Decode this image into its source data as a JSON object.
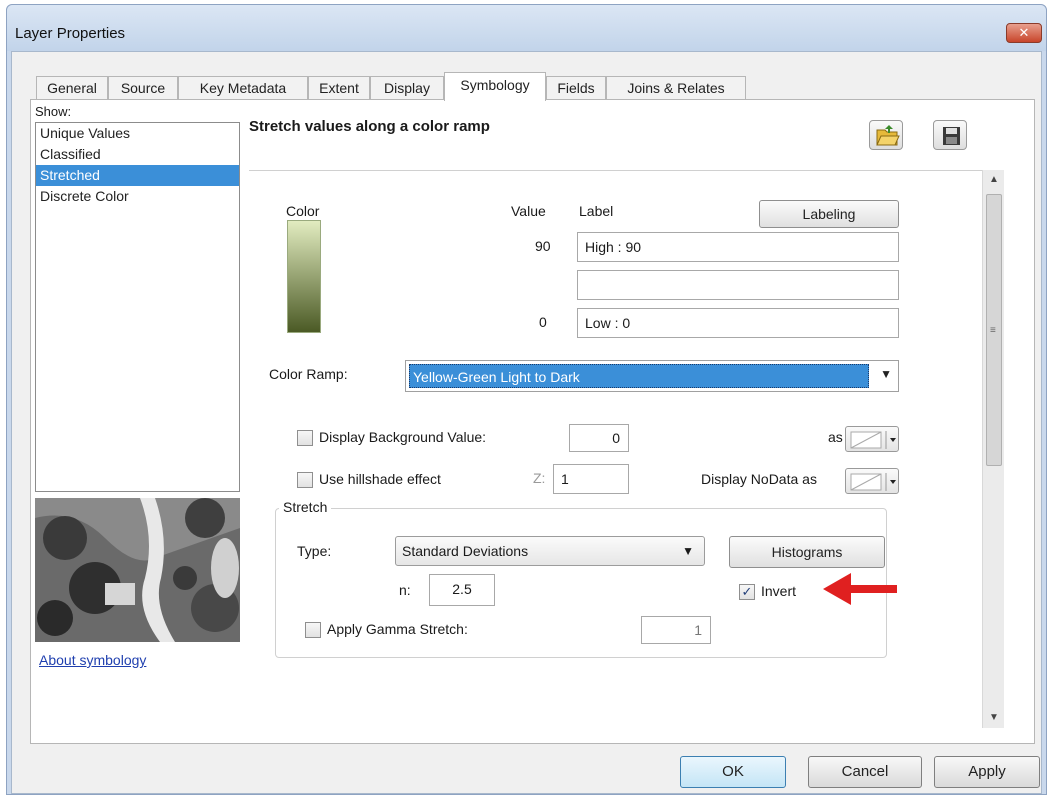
{
  "window": {
    "title": "Layer Properties",
    "close_glyph": "✕"
  },
  "tabs": [
    {
      "label": "General"
    },
    {
      "label": "Source"
    },
    {
      "label": "Key Metadata"
    },
    {
      "label": "Extent"
    },
    {
      "label": "Display"
    },
    {
      "label": "Symbology",
      "active": true
    },
    {
      "label": "Fields"
    },
    {
      "label": "Joins & Relates"
    }
  ],
  "show": {
    "label": "Show:",
    "items": [
      {
        "label": "Unique Values"
      },
      {
        "label": "Classified"
      },
      {
        "label": "Stretched",
        "selected": true
      },
      {
        "label": "Discrete Color"
      }
    ],
    "about_link": "About symbology"
  },
  "symbology": {
    "heading": "Stretch values along a color ramp",
    "icons": [
      "open-folder-icon",
      "save-icon"
    ],
    "color_label": "Color",
    "value_label": "Value",
    "label_label": "Label",
    "labeling_button": "Labeling",
    "high_value": "90",
    "high_label": "High : 90",
    "middle_label": "",
    "low_value": "0",
    "low_label": "Low : 0",
    "ramp_colors": [
      "#e2ecc0",
      "#4b5a25"
    ],
    "color_ramp_label": "Color Ramp:",
    "color_ramp_value": "Yellow-Green Light to Dark",
    "display_background_label": "Display Background Value:",
    "display_background_checked": false,
    "background_value": "0",
    "as_label": "as",
    "hillshade_label": "Use hillshade effect",
    "hillshade_checked": false,
    "z_label": "Z:",
    "z_value": "1",
    "nodata_label": "Display NoData as",
    "stretch": {
      "group_label": "Stretch",
      "type_label": "Type:",
      "type_value": "Standard Deviations",
      "histograms_button": "Histograms",
      "n_label": "n:",
      "n_value": "2.5",
      "invert_label": "Invert",
      "invert_checked": true,
      "gamma_label": "Apply Gamma Stretch:",
      "gamma_checked": false,
      "gamma_value": "1"
    }
  },
  "buttons": {
    "ok": "OK",
    "cancel": "Cancel",
    "apply": "Apply"
  },
  "colors": {
    "selection": "#3b8fd8",
    "arrow": "#e02020",
    "link": "#1f3faf"
  }
}
